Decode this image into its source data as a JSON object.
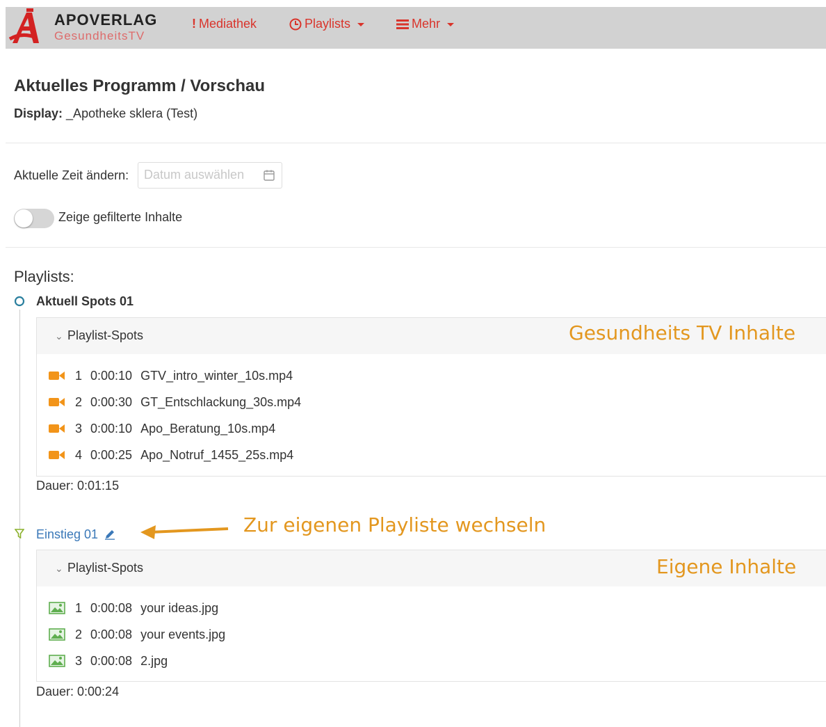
{
  "header": {
    "brand_title": "APOVERLAG",
    "brand_subtitle": "GesundheitsTV",
    "nav": [
      {
        "label": "Mediathek",
        "icon": "exclamation-icon"
      },
      {
        "label": "Playlists",
        "icon": "clock-icon"
      },
      {
        "label": "Mehr",
        "icon": "list-icon"
      }
    ],
    "accent_color": "#d9342b"
  },
  "page": {
    "title": "Aktuelles Programm / Vorschau",
    "display_label": "Display:",
    "display_value": "_Apotheke sklera (Test)",
    "time_label": "Aktuelle Zeit ändern:",
    "date_placeholder": "Datum auswählen",
    "toggle_label": "Zeige gefilterte Inhalte",
    "playlists_heading": "Playlists:"
  },
  "playlists": [
    {
      "title": "Aktuell Spots 01",
      "marker_icon": "circle-icon",
      "panel_title": "Playlist-Spots",
      "annotation": "Gesundheits TV Inhalte",
      "spots": [
        {
          "index": "1",
          "duration": "0:00:10",
          "file": "GTV_intro_winter_10s.mp4",
          "icon": "video-camera-icon"
        },
        {
          "index": "2",
          "duration": "0:00:30",
          "file": "GT_Entschlackung_30s.mp4",
          "icon": "video-camera-icon"
        },
        {
          "index": "3",
          "duration": "0:00:10",
          "file": "Apo_Beratung_10s.mp4",
          "icon": "video-camera-icon"
        },
        {
          "index": "4",
          "duration": "0:00:25",
          "file": "Apo_Notruf_1455_25s.mp4",
          "icon": "video-camera-icon"
        }
      ],
      "total": "Dauer: 0:01:15"
    },
    {
      "title": "Einstieg 01",
      "marker_icon": "filter-icon",
      "panel_title": "Playlist-Spots",
      "annotation": "Eigene Inhalte",
      "spots": [
        {
          "index": "1",
          "duration": "0:00:08",
          "file": "your ideas.jpg",
          "icon": "image-icon"
        },
        {
          "index": "2",
          "duration": "0:00:08",
          "file": "your events.jpg",
          "icon": "image-icon"
        },
        {
          "index": "3",
          "duration": "0:00:08",
          "file": "2.jpg",
          "icon": "image-icon"
        }
      ],
      "total": "Dauer: 0:00:24"
    }
  ],
  "annotations": {
    "switch_playlist": "Zur eigenen Playliste wechseln",
    "color": "#e3971f"
  }
}
